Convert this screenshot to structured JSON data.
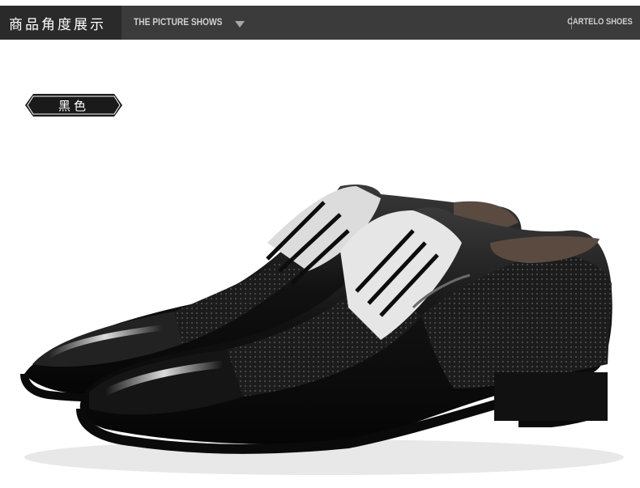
{
  "header": {
    "title_cn": "商品角度展示",
    "title_en": "THE PICTURE SHOWS",
    "brand": "CARTELO SHOES",
    "bg_color": "#3b3b3b"
  },
  "color_tag": {
    "label": "黑色",
    "bg_color": "#1a1a1a"
  },
  "product_photo": {
    "description": "pair of black leather lace-up dress shoes"
  }
}
